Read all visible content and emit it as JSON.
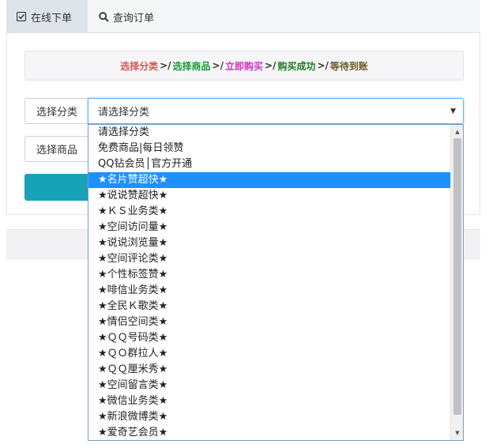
{
  "tabs": [
    {
      "label": "在线下单",
      "icon": "check-square-icon"
    },
    {
      "label": "查询订单",
      "icon": "search-icon"
    }
  ],
  "steps": {
    "items": [
      "选择分类",
      "选择商品",
      "立即购买",
      "购买成功",
      "等待到账"
    ],
    "separator": ">/",
    "colors": [
      "#d9534f",
      "#1a9c3a",
      "#d12fc4",
      "#1e7a1e",
      "#6b5a2a"
    ]
  },
  "form": {
    "category_label": "选择分类",
    "category_value": "请选择分类",
    "product_label": "选择商品"
  },
  "dropdown": {
    "selected_index": 3,
    "options": [
      "请选择分类",
      "免费商品|每日领赞",
      "QQ钻会员│官方开通",
      "★名片赞超快★",
      "★说说赞超快★",
      "★ＫＳ业务类★",
      "★空间访问量★",
      "★说说浏览量★",
      "★空间评论类★",
      "★个性标签赞★",
      "★啡信业务类★",
      "★全民Ｋ歌类★",
      "★情侣空间类★",
      "★ＱＱ号码类★",
      "★ＱＯ群拉人★",
      "★ＱＱ厘米秀★",
      "★空间留言类★",
      "★微信业务类★",
      "★新浪微博类★",
      "★爱奇艺会员★"
    ]
  },
  "accent_color": "#17a2b8",
  "highlight_color": "#1e90ff"
}
